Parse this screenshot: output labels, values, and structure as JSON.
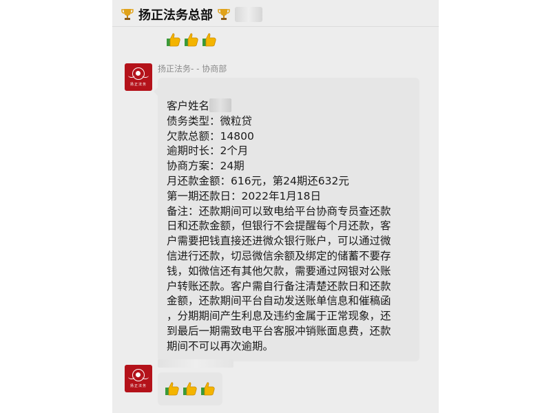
{
  "header": {
    "title": "扬正法务总部"
  },
  "sender1": {
    "name": "扬正法务- - 协商部",
    "avatar_text": "扬正法务"
  },
  "message": {
    "lines": [
      "客户姓名",
      "债务类型：微粒贷",
      "欠款总额：14800",
      "逾期时长：2个月",
      "协商方案：24期",
      "月还款金额：616元，第24期还632元",
      "第一期还款日：2022年1月18日",
      "备注：还款期间可以致电给平台协商专员查还款",
      "日和还款金额，但银行不会提醒每个月还款，客",
      "户需要把钱直接还进微众银行账户，可以通过微",
      "信进行还款，切忌微信余额及绑定的储蓄不要存",
      "钱，如微信还有其他欠款，需要通过网银对公账",
      "户转账还款。客户需自行备注清楚还款日和还款",
      "金额，还款期间平台自动发送账单信息和催稿函",
      "，分期期间产生利息及违约金属于正常现象，还",
      "到最后一期需致电平台客服冲销账面息费，还款",
      "期间不可以再次逾期。"
    ]
  },
  "icons": {
    "trophy": "trophy-icon",
    "thumbs_up": "thumbs-up-icon"
  },
  "colors": {
    "chat_bg": "#ededed",
    "bubble_bg": "#e6e6e6",
    "avatar_red": "#b4121a",
    "trophy_gold": "#e0a21a",
    "thumb_yellow": "#f4b400",
    "cuff_green": "#3a9a3a"
  }
}
